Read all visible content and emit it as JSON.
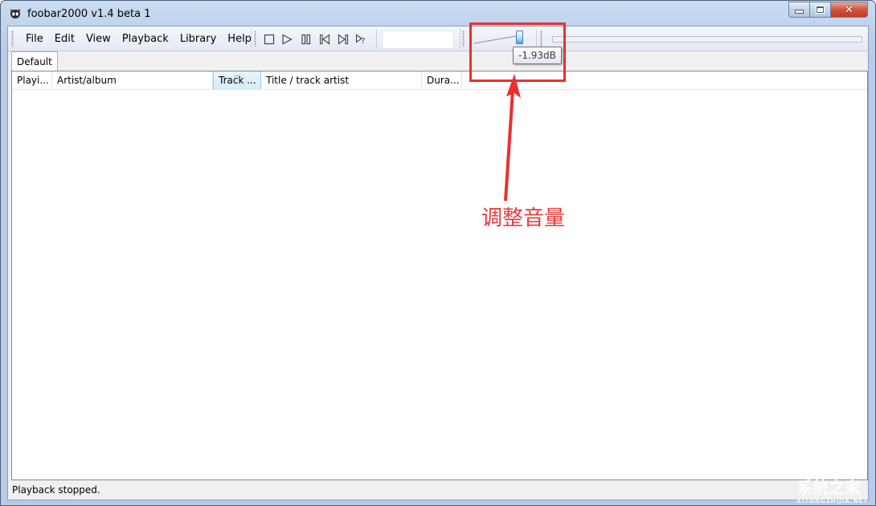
{
  "window": {
    "title": "foobar2000 v1.4 beta 1",
    "controls": {
      "minimize": "minimize-icon",
      "maximize": "maximize-icon",
      "close": "close-icon"
    }
  },
  "menu": {
    "items": [
      "File",
      "Edit",
      "View",
      "Playback",
      "Library",
      "Help"
    ]
  },
  "transport": {
    "buttons": [
      {
        "name": "stop",
        "icon": "stop-icon"
      },
      {
        "name": "play",
        "icon": "play-icon"
      },
      {
        "name": "pause",
        "icon": "pause-icon"
      },
      {
        "name": "previous",
        "icon": "previous-icon"
      },
      {
        "name": "next",
        "icon": "next-icon"
      },
      {
        "name": "random",
        "icon": "random-icon"
      }
    ]
  },
  "volume": {
    "tooltip": "-1.93dB",
    "level_fraction": 0.92
  },
  "seek": {
    "position_fraction": 0
  },
  "playlist_tabs": [
    {
      "label": "Default",
      "active": true
    }
  ],
  "playlist": {
    "columns": [
      {
        "label": "Playi..."
      },
      {
        "label": "Artist/album"
      },
      {
        "label": "Track ...",
        "sorted": true
      },
      {
        "label": "Title / track artist"
      },
      {
        "label": "Dura..."
      }
    ],
    "rows": []
  },
  "status": {
    "text": "Playback stopped."
  },
  "annotation": {
    "text": "调整音量",
    "color": "#e83a3a"
  },
  "watermark": {
    "text": "系统之家",
    "subtext": "XITONGZHIJIA.NET"
  }
}
